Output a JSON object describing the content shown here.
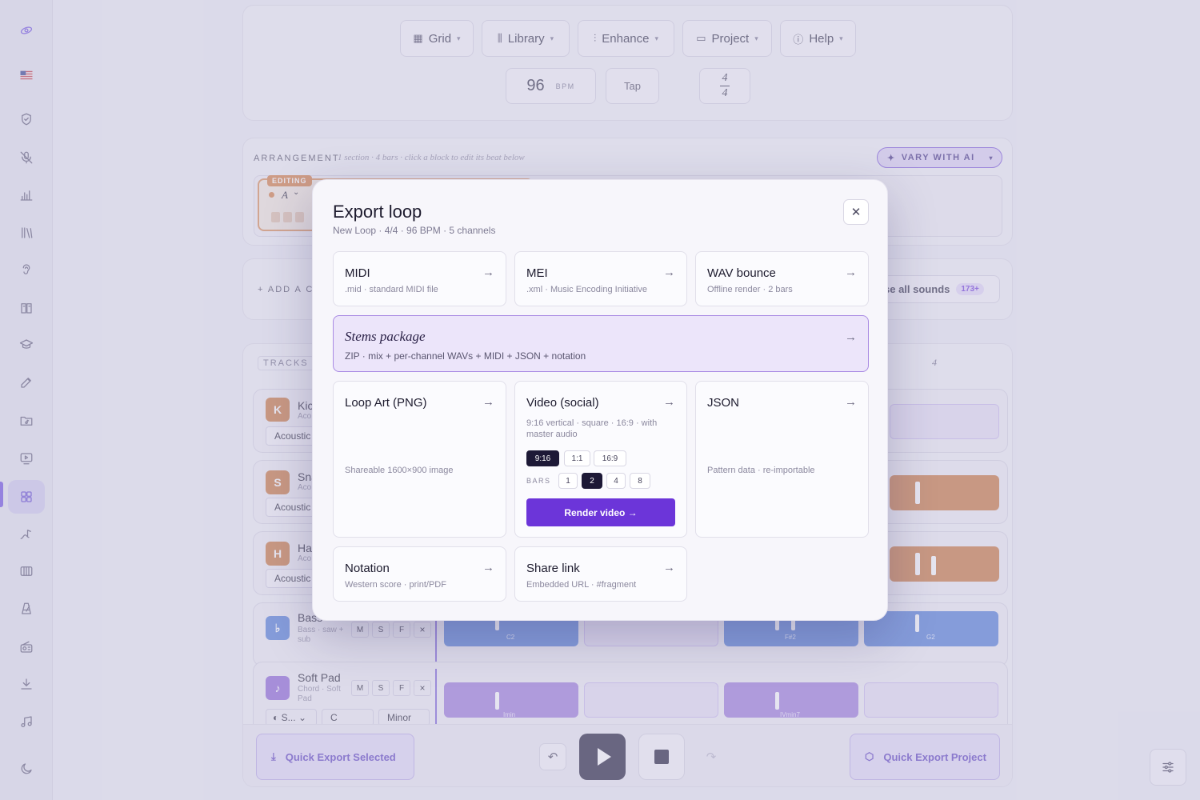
{
  "sidebar": {
    "icons": [
      "logo-icon",
      "flag-us-icon",
      "shield-icon",
      "mic-off-icon",
      "bars-icon",
      "library-icon",
      "ear-icon",
      "book-icon",
      "graduation-icon",
      "edit-icon",
      "folder-music-icon",
      "monitor-play-icon",
      "grid-icon",
      "staff-icon",
      "piano-icon",
      "metronome-icon",
      "radio-icon",
      "download-icon",
      "music-note-icon",
      "moon-icon"
    ]
  },
  "toolbar": {
    "grid_label": "Grid",
    "library_label": "Library",
    "enhance_label": "Enhance",
    "project_label": "Project",
    "help_label": "Help",
    "bpm_value": "96",
    "bpm_unit": "BPM",
    "tap_label": "Tap",
    "time_sig_top": "4",
    "time_sig_bottom": "4"
  },
  "arrangement": {
    "label": "ARRANGEMENT",
    "hint": "1 section · 4 bars · click a block to edit its beat below",
    "vary_label": "VARY WITH AI",
    "editing_badge": "EDITING",
    "section_name": "A"
  },
  "sounds": {
    "add_label": "+ ADD A C",
    "browse_label": "se all sounds",
    "count_badge": "173+"
  },
  "tracks": {
    "header_label": "TRACKS",
    "beat_number": "4",
    "rows": [
      {
        "initial": "K",
        "name": "Kic",
        "sub": "Aco",
        "preset": "Acoustic",
        "color": "#c8733a"
      },
      {
        "initial": "S",
        "name": "Sna",
        "sub": "Aco",
        "preset": "Acoustic",
        "color": "#c8733a"
      },
      {
        "initial": "H",
        "name": "Hat",
        "sub": "Aco",
        "preset": "Acoustic",
        "color": "#c8733a"
      },
      {
        "initial": "♭",
        "name": "Bass",
        "sub": "Bass · saw + sub",
        "color": "#4f7bd8",
        "chord_labels": [
          "C2",
          "F#2",
          "G2"
        ]
      },
      {
        "initial": "♪",
        "name": "Soft Pad",
        "sub": "Chord · Soft Pad",
        "color": "#8a62d6",
        "select1": "S...",
        "select2": "C",
        "select3": "Minor",
        "chord_labels": [
          "Imin",
          "IVmin7"
        ]
      }
    ],
    "track_buttons": [
      "M",
      "S",
      "F",
      "×"
    ]
  },
  "bottom_bar": {
    "quick_export_selected": "Quick Export Selected",
    "quick_export_project": "Quick Export Project"
  },
  "modal": {
    "title": "Export loop",
    "subtitle": "New Loop · 4/4 · 96 BPM · 5 channels",
    "close_icon": "close-icon",
    "cards": {
      "midi": {
        "title": "MIDI",
        "sub": ".mid · standard MIDI file"
      },
      "mei": {
        "title": "MEI",
        "sub": ".xml · Music Encoding Initiative"
      },
      "wav": {
        "title": "WAV bounce",
        "sub": "Offline render · 2 bars"
      },
      "stems": {
        "title": "Stems package",
        "sub": "ZIP · mix + per-channel WAVs + MIDI + JSON + notation"
      },
      "loopart": {
        "title": "Loop Art (PNG)",
        "sub": "Shareable 1600×900 image"
      },
      "video": {
        "title": "Video (social)",
        "sub": "9:16 vertical · square · 16:9 · with master audio",
        "aspects": [
          "9:16",
          "1:1",
          "16:9"
        ],
        "selected_aspect": "9:16",
        "bars_label": "BARS",
        "bars": [
          "1",
          "2",
          "4",
          "8"
        ],
        "selected_bars": "2",
        "render_label": "Render video →"
      },
      "json": {
        "title": "JSON",
        "sub": "Pattern data · re-importable"
      },
      "notation": {
        "title": "Notation",
        "sub": "Western score · print/PDF"
      },
      "share": {
        "title": "Share link",
        "sub": "Embedded URL · #fragment"
      }
    },
    "arrow": "→"
  },
  "colors": {
    "accent": "#6c35d9",
    "drum": "#c8733a",
    "bass": "#4f7bd8",
    "pad": "#8a62d6",
    "dark": "#1d1936"
  }
}
